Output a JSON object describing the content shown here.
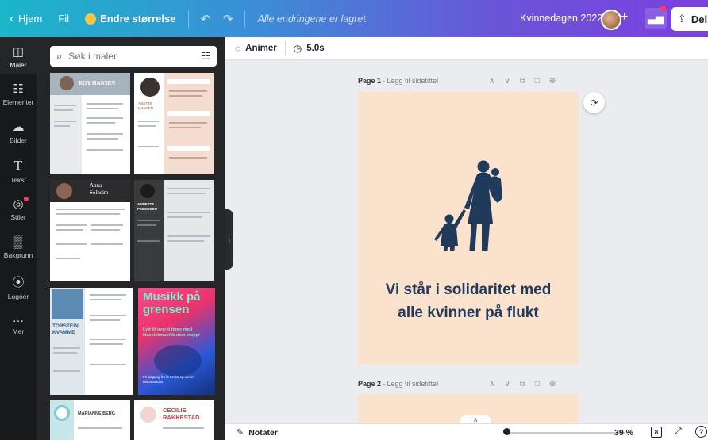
{
  "topbar": {
    "home": "Hjem",
    "file": "Fil",
    "resize": "Endre størrelse",
    "saved_status": "Alle endringene er lagret",
    "design_title": "Kvinnedagen 2022",
    "share": "Del",
    "icons": [
      "chevron-left-icon",
      "crown-icon",
      "undo-icon",
      "redo-icon",
      "plus-icon",
      "chart-icon",
      "share-icon"
    ]
  },
  "rail": {
    "items": [
      {
        "label": "Maler",
        "icon": "template-icon"
      },
      {
        "label": "Elementer",
        "icon": "elements-icon"
      },
      {
        "label": "Bilder",
        "icon": "upload-cloud-icon"
      },
      {
        "label": "Tekst",
        "icon": "text-icon"
      },
      {
        "label": "Stiler",
        "icon": "palette-icon"
      },
      {
        "label": "Bakgrunn",
        "icon": "pattern-icon"
      },
      {
        "label": "Logoer",
        "icon": "logo-icon"
      },
      {
        "label": "Mer",
        "icon": "more-icon"
      }
    ]
  },
  "panel": {
    "search_placeholder": "Søk i maler",
    "templates": [
      {
        "name": "ROY HANSEN"
      },
      {
        "name": "ANETTE HANSEN"
      },
      {
        "name": "Anna Solheim"
      },
      {
        "name": "ANNETTE PEDERSEN"
      },
      {
        "name": "TORSTEIN KVAMME"
      },
      {
        "name": "Musikk på grensen",
        "subtitle": "Lytt til over ti timer med klassiskmusikk uten stopp!",
        "footer": "Fri adgang fra kl 14:00 og utover Bislettstadion"
      },
      {
        "name": "MARIANNE BERG"
      },
      {
        "name": "CECILIE RAKKESTAD"
      }
    ]
  },
  "editor_toolbar": {
    "animate": "Animer",
    "duration": "5.0s"
  },
  "pages": [
    {
      "label": "Page 1",
      "title_hint": "- Legg til sidetittel",
      "text_line1": "Vi står i solidaritet med",
      "text_line2": "alle kvinner på flukt",
      "background": "#fbe2cc",
      "text_color": "#203a5c"
    },
    {
      "label": "Page 2",
      "title_hint": "- Legg til sidetittel",
      "background": "#fbe2cc"
    }
  ],
  "bottombar": {
    "notes": "Notater",
    "zoom": "39 %",
    "page_count": "8",
    "zoom_fraction": 0.39
  },
  "colors": {
    "rail_bg": "#18191b",
    "panel_bg": "#252627",
    "canvas_bg": "#ebecf0",
    "accent_purple": "#7b3fe0",
    "accent_teal": "#1bb6c9"
  }
}
